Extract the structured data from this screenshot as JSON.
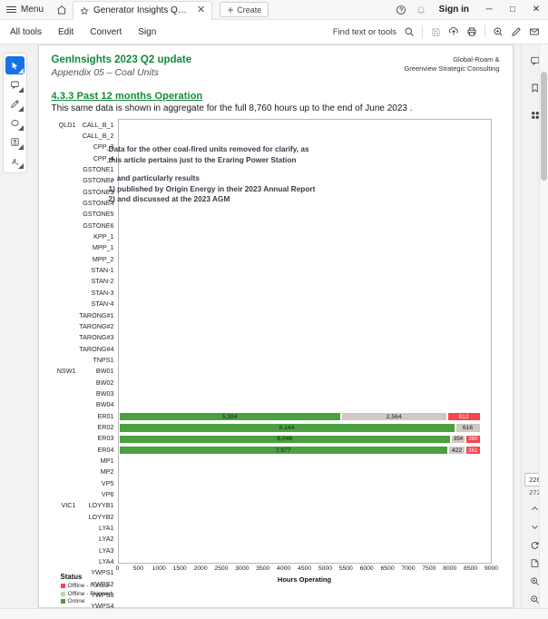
{
  "titlebar": {
    "menu_label": "Menu",
    "tab_title": "Generator Insights Qua...",
    "create_label": "Create",
    "signin_label": "Sign in",
    "minimize": "─",
    "maximize": "□",
    "close": "✕",
    "tab_close": "✕"
  },
  "toolbar": {
    "items": [
      "All tools",
      "Edit",
      "Convert",
      "Sign"
    ],
    "find_label": "Find text or tools"
  },
  "leftrail": {
    "tools": [
      "select-cursor",
      "add-comment",
      "draw-pen",
      "highlight-oval",
      "add-stamp",
      "add-signature"
    ]
  },
  "rightrail": {
    "top_tools": [
      "comment-panel",
      "bookmark-panel",
      "thumbnail-panel"
    ],
    "page_current": "226",
    "page_total": "272",
    "bottom_tools": [
      "page-up",
      "page-down",
      "rotate",
      "fit-page",
      "zoom-in",
      "zoom-out"
    ]
  },
  "document": {
    "title": "GenInsights 2023 Q2 update",
    "subtitle": "Appendix 05 – Coal Units",
    "org_line1": "Global-Roam &",
    "org_line2": "Greenview Strategic Consulting",
    "section_heading": "4.3.3   Past 12 months Operation",
    "section_paragraph": "This same data is shown in aggregate for the full 8,760 hours up to the end of June 2023 .",
    "annotation": [
      "Data for the other coal-fired units removed for clarify, as",
      "this article pertains just to the Eraring Power Station",
      "... and particularly results",
      "1)  published by Origin Energy in their 2023 Annual Report",
      "2)  and discussed at the 2023 AGM"
    ]
  },
  "chart_data": {
    "type": "bar",
    "orientation": "horizontal",
    "stacked": true,
    "title": "",
    "xlabel": "Hours Operating",
    "ylabel": "",
    "xlim": [
      0,
      9000
    ],
    "xticks": [
      0,
      500,
      1000,
      1500,
      2000,
      2500,
      3000,
      3500,
      4000,
      4500,
      5000,
      5500,
      6000,
      6500,
      7000,
      7500,
      8000,
      8500,
      9000
    ],
    "grid": false,
    "legend": {
      "title": "Status",
      "position": "below-left",
      "entries": [
        {
          "label": "Offline - Forced",
          "color": "#f8444f"
        },
        {
          "label": "Offline - Planned",
          "color": "#cfc8c4"
        },
        {
          "label": "Online",
          "color": "#4ba03f"
        }
      ]
    },
    "series": [
      {
        "name": "Online",
        "color": "#4ba03f"
      },
      {
        "name": "Offline - Planned",
        "color": "#cfc8c4"
      },
      {
        "name": "Offline - Forced",
        "color": "#f8444f"
      }
    ],
    "regions": [
      {
        "name": "QLD1",
        "start": 0,
        "count": 23
      },
      {
        "name": "NSW1",
        "start": 23,
        "count": 12
      },
      {
        "name": "VIC1",
        "start": 35,
        "count": 10
      }
    ],
    "rows": [
      {
        "region": "QLD1",
        "unit": "CALL_B_1",
        "online": 60,
        "planned": 0,
        "forced": 0,
        "labels": {}
      },
      {
        "region": "",
        "unit": "CALL_B_2",
        "online": 60,
        "planned": 0,
        "forced": 0,
        "labels": {}
      },
      {
        "region": "",
        "unit": "CPP_3",
        "online": 60,
        "planned": 0,
        "forced": 0,
        "labels": {}
      },
      {
        "region": "",
        "unit": "CPP_4",
        "online": 0,
        "planned": 0,
        "forced": 60,
        "labels": {}
      },
      {
        "region": "",
        "unit": "GSTONE1",
        "online": 60,
        "planned": 0,
        "forced": 0,
        "labels": {}
      },
      {
        "region": "",
        "unit": "GSTONE2",
        "online": 60,
        "planned": 0,
        "forced": 0,
        "labels": {}
      },
      {
        "region": "",
        "unit": "GSTONE3",
        "online": 60,
        "planned": 0,
        "forced": 0,
        "labels": {}
      },
      {
        "region": "",
        "unit": "GSTONE4",
        "online": 60,
        "planned": 0,
        "forced": 0,
        "labels": {}
      },
      {
        "region": "",
        "unit": "GSTONE5",
        "online": 60,
        "planned": 0,
        "forced": 0,
        "labels": {}
      },
      {
        "region": "",
        "unit": "GSTONE6",
        "online": 60,
        "planned": 0,
        "forced": 0,
        "labels": {}
      },
      {
        "region": "",
        "unit": "KPP_1",
        "online": 60,
        "planned": 0,
        "forced": 0,
        "labels": {}
      },
      {
        "region": "",
        "unit": "MPP_1",
        "online": 60,
        "planned": 0,
        "forced": 0,
        "labels": {}
      },
      {
        "region": "",
        "unit": "MPP_2",
        "online": 60,
        "planned": 0,
        "forced": 0,
        "labels": {}
      },
      {
        "region": "",
        "unit": "STAN-1",
        "online": 60,
        "planned": 0,
        "forced": 0,
        "labels": {}
      },
      {
        "region": "",
        "unit": "STAN-2",
        "online": 60,
        "planned": 0,
        "forced": 0,
        "labels": {}
      },
      {
        "region": "",
        "unit": "STAN-3",
        "online": 60,
        "planned": 0,
        "forced": 0,
        "labels": {}
      },
      {
        "region": "",
        "unit": "STAN-4",
        "online": 60,
        "planned": 0,
        "forced": 0,
        "labels": {}
      },
      {
        "region": "",
        "unit": "TARONG#1",
        "online": 60,
        "planned": 0,
        "forced": 0,
        "labels": {}
      },
      {
        "region": "",
        "unit": "TARONG#2",
        "online": 60,
        "planned": 0,
        "forced": 0,
        "labels": {}
      },
      {
        "region": "",
        "unit": "TARONG#3",
        "online": 60,
        "planned": 0,
        "forced": 0,
        "labels": {}
      },
      {
        "region": "",
        "unit": "TARONG#4",
        "online": 60,
        "planned": 0,
        "forced": 0,
        "labels": {}
      },
      {
        "region": "",
        "unit": "TNPS1",
        "online": 60,
        "planned": 0,
        "forced": 0,
        "labels": {}
      },
      {
        "region": "NSW1",
        "unit": "BW01",
        "online": 60,
        "planned": 0,
        "forced": 0,
        "labels": {}
      },
      {
        "region": "",
        "unit": "BW02",
        "online": 60,
        "planned": 0,
        "forced": 0,
        "labels": {}
      },
      {
        "region": "",
        "unit": "BW03",
        "online": 60,
        "planned": 0,
        "forced": 0,
        "labels": {}
      },
      {
        "region": "",
        "unit": "BW04",
        "online": 60,
        "planned": 0,
        "forced": 0,
        "labels": {}
      },
      {
        "region": "",
        "unit": "ER01",
        "online": 5384,
        "planned": 2564,
        "forced": 812,
        "labels": {
          "online": "5,384",
          "planned": "2,564",
          "forced": "812"
        }
      },
      {
        "region": "",
        "unit": "ER02",
        "online": 8144,
        "planned": 616,
        "forced": 0,
        "labels": {
          "online": "8,144",
          "planned": "616"
        }
      },
      {
        "region": "",
        "unit": "ER03",
        "online": 8046,
        "planned": 354,
        "forced": 360,
        "labels": {
          "online": "8,046",
          "planned": "354",
          "forced": "360"
        }
      },
      {
        "region": "",
        "unit": "ER04",
        "online": 7977,
        "planned": 422,
        "forced": 361,
        "labels": {
          "online": "7,977",
          "planned": "422",
          "forced": "361"
        }
      },
      {
        "region": "",
        "unit": "MP1",
        "online": 0,
        "planned": 0,
        "forced": 0,
        "labels": {}
      },
      {
        "region": "",
        "unit": "MP2",
        "online": 0,
        "planned": 0,
        "forced": 0,
        "labels": {}
      },
      {
        "region": "",
        "unit": "VP5",
        "online": 0,
        "planned": 0,
        "forced": 0,
        "labels": {}
      },
      {
        "region": "",
        "unit": "VP6",
        "online": 0,
        "planned": 0,
        "forced": 0,
        "labels": {}
      },
      {
        "region": "VIC1",
        "unit": "LOYYB1",
        "online": 0,
        "planned": 0,
        "forced": 0,
        "labels": {}
      },
      {
        "region": "",
        "unit": "LOYYB2",
        "online": 0,
        "planned": 0,
        "forced": 0,
        "labels": {}
      },
      {
        "region": "",
        "unit": "LYA1",
        "online": 0,
        "planned": 0,
        "forced": 0,
        "labels": {}
      },
      {
        "region": "",
        "unit": "LYA2",
        "online": 0,
        "planned": 0,
        "forced": 0,
        "labels": {}
      },
      {
        "region": "",
        "unit": "LYA3",
        "online": 0,
        "planned": 0,
        "forced": 0,
        "labels": {}
      },
      {
        "region": "",
        "unit": "LYA4",
        "online": 0,
        "planned": 0,
        "forced": 0,
        "labels": {}
      },
      {
        "region": "",
        "unit": "YWPS1",
        "online": 0,
        "planned": 0,
        "forced": 0,
        "labels": {}
      },
      {
        "region": "",
        "unit": "YWPS2",
        "online": 0,
        "planned": 0,
        "forced": 0,
        "labels": {}
      },
      {
        "region": "",
        "unit": "YWPS3",
        "online": 0,
        "planned": 0,
        "forced": 0,
        "labels": {}
      },
      {
        "region": "",
        "unit": "YWPS4",
        "online": 0,
        "planned": 0,
        "forced": 0,
        "labels": {}
      }
    ]
  }
}
